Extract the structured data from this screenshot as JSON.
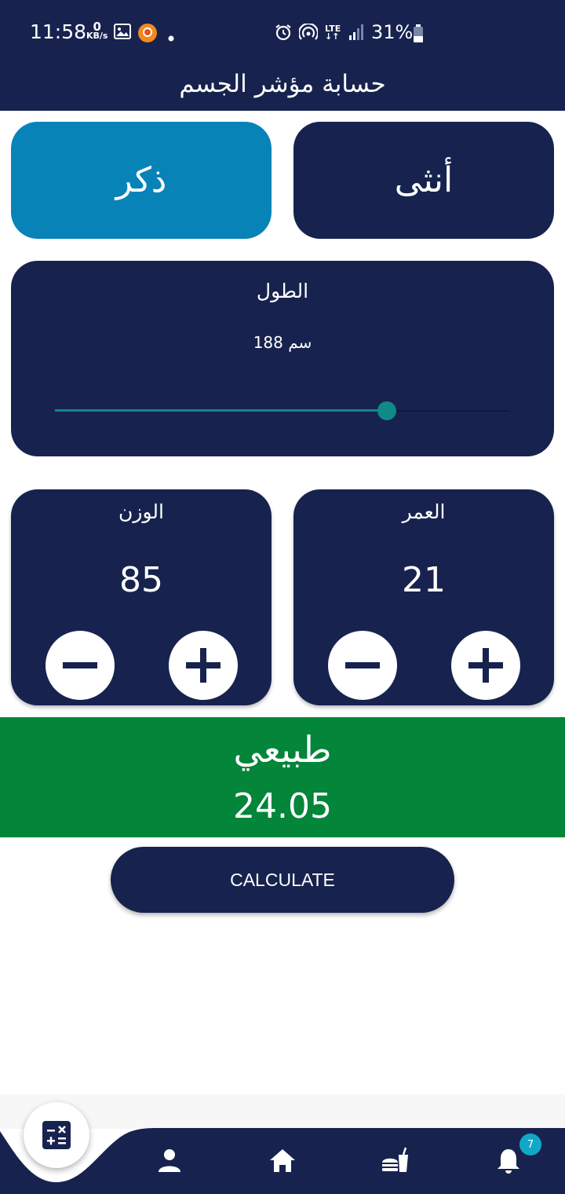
{
  "status_bar": {
    "time": "11:58",
    "net_speed_value": "0",
    "net_speed_unit": "KB/s",
    "network_type": "LTE",
    "battery_percent": "31%"
  },
  "app_bar": {
    "title": "حسابة مؤشر الجسم"
  },
  "gender": {
    "male_label": "ذكر",
    "female_label": "أنثى",
    "selected": "male"
  },
  "height": {
    "label": "الطول",
    "value_text": "188 سم",
    "slider_fraction": 0.73
  },
  "weight": {
    "label": "الوزن",
    "value": "85"
  },
  "age": {
    "label": "العمر",
    "value": "21"
  },
  "result": {
    "category": "طبيعي",
    "bmi": "24.05"
  },
  "calculate_label": "CALCULATE",
  "bottom_nav": {
    "items": [
      "calculator-icon",
      "person-icon",
      "home-icon",
      "fastfood-icon",
      "bell-icon"
    ],
    "notification_count": "7"
  },
  "colors": {
    "navy": "#17234e",
    "selected_blue": "#0783b8",
    "teal": "#0f8a88",
    "result_green": "#03853a",
    "badge": "#10a8c9"
  }
}
